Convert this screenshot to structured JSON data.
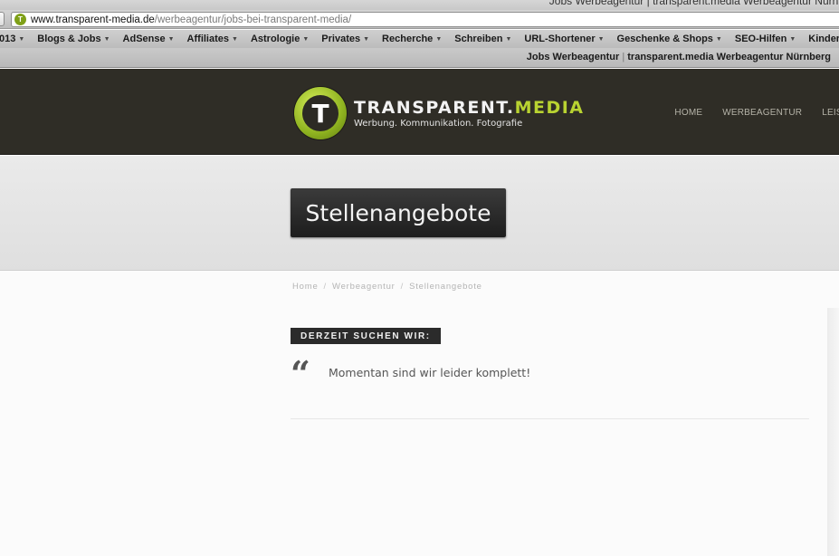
{
  "browser": {
    "window_title": "Jobs Werbeagentur | transparent.media Werbeagentur Nürnb",
    "url_domain": "www.transparent-media.de",
    "url_path": "/werbeagentur/jobs-bei-transparent-media/",
    "favicon_letter": "T",
    "tab_title_part1": "Jobs Werbeagentur",
    "tab_title_sep": "|",
    "tab_title_part2": "transparent.media Werbeagentur Nürnberg",
    "bookmarks": [
      {
        "label": "013",
        "has_menu": true
      },
      {
        "label": "Blogs & Jobs",
        "has_menu": true
      },
      {
        "label": "AdSense",
        "has_menu": true
      },
      {
        "label": "Affiliates",
        "has_menu": true
      },
      {
        "label": "Astrologie",
        "has_menu": true
      },
      {
        "label": "Privates",
        "has_menu": true
      },
      {
        "label": "Recherche",
        "has_menu": true
      },
      {
        "label": "Schreiben",
        "has_menu": true
      },
      {
        "label": "URL-Shortener",
        "has_menu": true
      },
      {
        "label": "Geschenke & Shops",
        "has_menu": true
      },
      {
        "label": "SEO-Hilfen",
        "has_menu": true
      },
      {
        "label": "Kinder",
        "has_menu": false
      }
    ],
    "bookmark_arrow": "▼"
  },
  "header": {
    "logo_letter": "T",
    "brand_main": "TRANSPARENT.",
    "brand_accent": "MEDIA",
    "tagline": "Werbung. Kommunikation. Fotografie",
    "nav": [
      "HOME",
      "WERBEAGENTUR",
      "LEIST"
    ],
    "colors": {
      "background": "#2f2d26",
      "accent": "#b9d331"
    }
  },
  "page": {
    "title": "Stellenangebote",
    "breadcrumb": [
      "Home",
      "Werbeagentur",
      "Stellenangebote"
    ],
    "breadcrumb_sep": "/",
    "section_label": "DERZEIT SUCHEN WIR:",
    "quote_mark": "“",
    "quote_text": "Momentan sind wir leider komplett!"
  }
}
